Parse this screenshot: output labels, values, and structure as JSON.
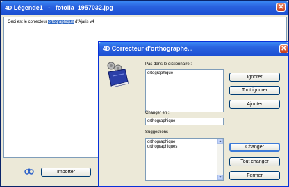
{
  "legend_window": {
    "title": "Légende1",
    "title_separator": "-",
    "title_file": "fotolia_1957032.jpg",
    "text_before": "Ceci est le correcteur ",
    "text_selected": "ortographique",
    "text_after": " d'Ajaris v4",
    "import_button": "Importer"
  },
  "spell_dialog": {
    "title": "Correcteur d'orthographe...",
    "not_in_dictionary_label": "Pas dans le dictionnaire :",
    "not_in_dictionary_value": "ortographique",
    "change_to_label": "Changer en :",
    "change_to_value": "orthographique",
    "suggestions_label": "Suggestions :",
    "suggestions": [
      "orthographique",
      "orthographiques"
    ],
    "buttons": {
      "ignore": "Ignorer",
      "ignore_all": "Tout ignorer",
      "add": "Ajouter",
      "change": "Changer",
      "change_all": "Tout changer",
      "close": "Fermer"
    }
  },
  "colors": {
    "titlebar": "#2a63e0",
    "selection": "#316ac5",
    "dialog_bg": "#ece9d8"
  },
  "icons": {
    "app_logo": "4D-logo-icon",
    "close": "close-icon",
    "book": "dictionary-book-icon",
    "link": "link-icon"
  }
}
